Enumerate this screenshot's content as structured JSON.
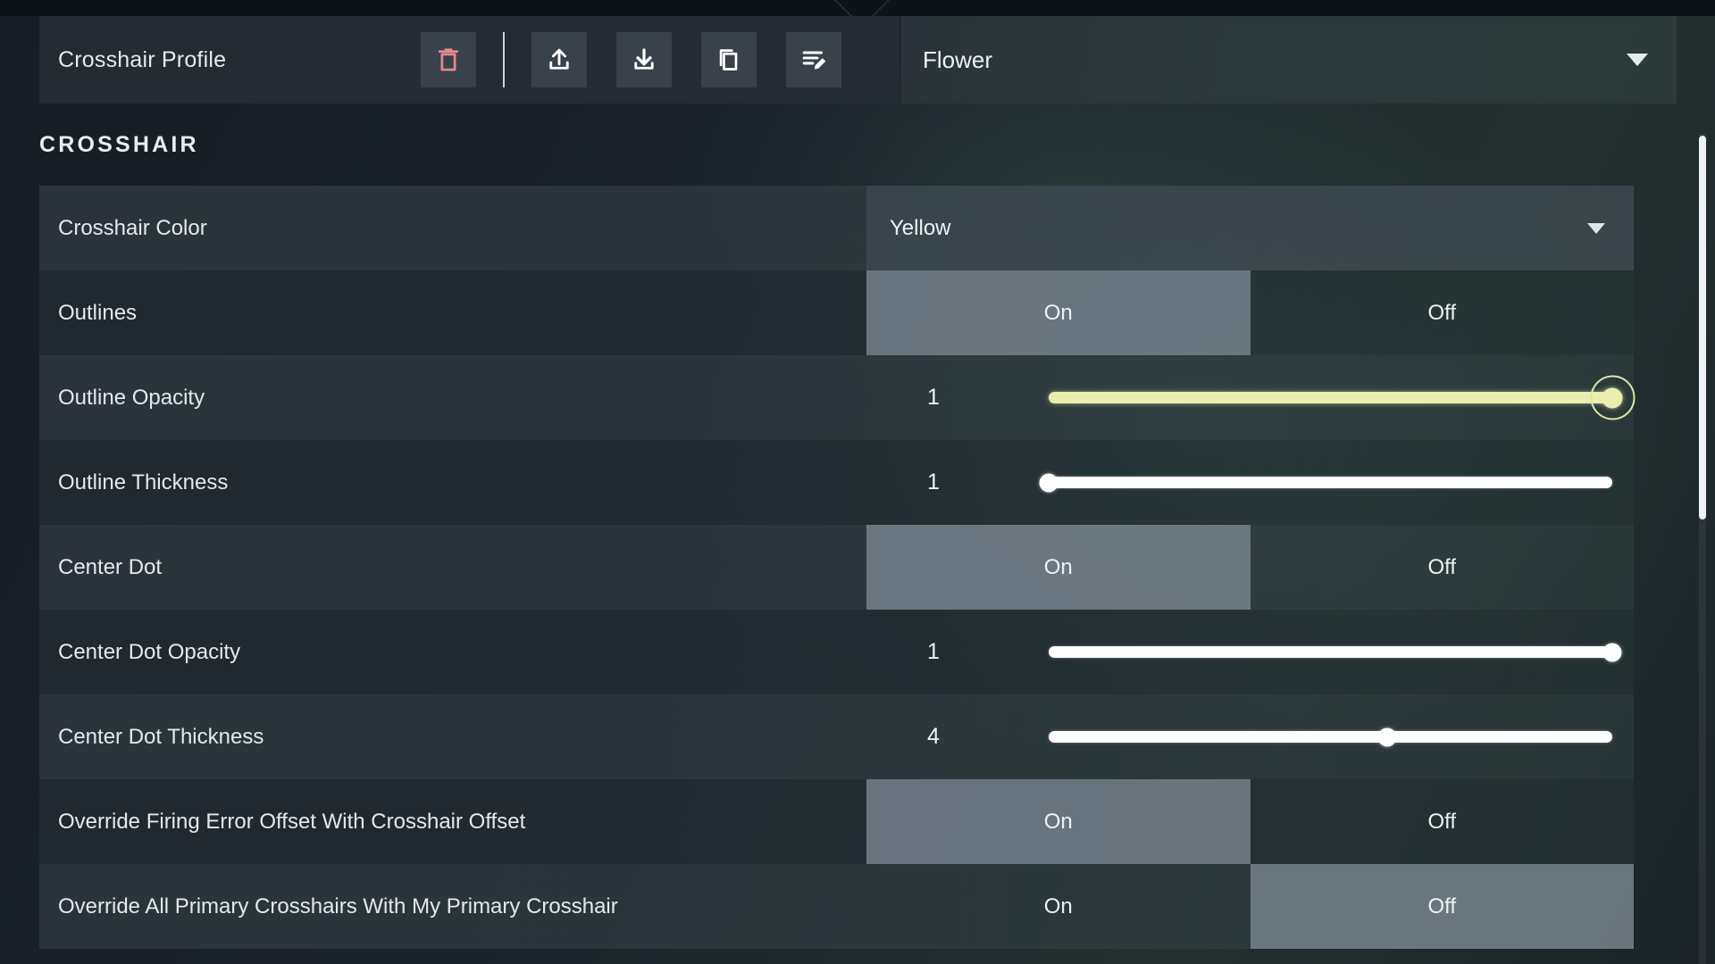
{
  "profile_bar": {
    "label": "Crosshair Profile",
    "selected_profile": "Flower",
    "caret_icon": "chevron-down-icon",
    "actions": [
      {
        "name": "delete-profile-button",
        "icon": "trash-icon",
        "color": "#e8888f"
      },
      {
        "name": "export-profile-button",
        "icon": "upload-icon",
        "color": "#ffffff"
      },
      {
        "name": "import-profile-button",
        "icon": "download-icon",
        "color": "#ffffff"
      },
      {
        "name": "duplicate-profile-button",
        "icon": "copy-icon",
        "color": "#ffffff"
      },
      {
        "name": "rename-profile-button",
        "icon": "rename-edit-icon",
        "color": "#ffffff"
      }
    ]
  },
  "section": {
    "title": "CROSSHAIR"
  },
  "settings": [
    {
      "label": "Crosshair Color",
      "type": "dropdown",
      "value": "Yellow",
      "name": "crosshair-color"
    },
    {
      "label": "Outlines",
      "type": "toggle",
      "on_label": "On",
      "off_label": "Off",
      "value": "On",
      "name": "outlines"
    },
    {
      "label": "Outline Opacity",
      "type": "slider",
      "value": "1",
      "percent": 100,
      "focused": true,
      "name": "outline-opacity"
    },
    {
      "label": "Outline Thickness",
      "type": "slider",
      "value": "1",
      "percent": 0,
      "focused": false,
      "name": "outline-thickness"
    },
    {
      "label": "Center Dot",
      "type": "toggle",
      "on_label": "On",
      "off_label": "Off",
      "value": "On",
      "name": "center-dot"
    },
    {
      "label": "Center Dot Opacity",
      "type": "slider",
      "value": "1",
      "percent": 100,
      "focused": false,
      "name": "center-dot-opacity"
    },
    {
      "label": "Center Dot Thickness",
      "type": "slider",
      "value": "4",
      "percent": 60,
      "focused": false,
      "name": "center-dot-thickness"
    },
    {
      "label": "Override Firing Error Offset With Crosshair Offset",
      "type": "toggle",
      "on_label": "On",
      "off_label": "Off",
      "value": "On",
      "name": "override-firing-error-offset"
    },
    {
      "label": "Override All Primary Crosshairs With My Primary Crosshair",
      "type": "toggle",
      "on_label": "On",
      "off_label": "Off",
      "value": "Off",
      "name": "override-all-primary-crosshairs"
    }
  ],
  "colors": {
    "accent_yellow": "#e9eeae",
    "delete_red": "#e8888f",
    "panel": "#242b33",
    "row_odd": "#2c363e",
    "row_even": "#212931"
  }
}
